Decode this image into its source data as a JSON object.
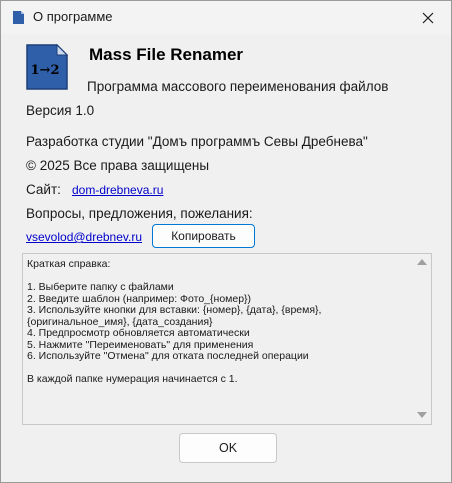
{
  "window": {
    "title": "О программе",
    "close_glyph": "✕"
  },
  "app": {
    "icon_label": "1→2",
    "name": "Mass File Renamer",
    "description": "Программа массового переименования файлов",
    "version": "Версия 1.0",
    "developer": "Разработка студии \"Домъ программъ Севы Дребнева\"",
    "copyright": "© 2025 Все права защищены"
  },
  "site": {
    "label": "Сайт:",
    "link": "dom-drebneva.ru"
  },
  "contact": {
    "prompt": "Вопросы, предложения, пожелания:",
    "email": "vsevolod@drebnev.ru",
    "copy_label": "Копировать"
  },
  "help": {
    "lines": [
      "Краткая справка:",
      "",
      "1. Выберите папку с файлами",
      "2. Введите шаблон (например: Фото_{номер})",
      "3. Используйте кнопки для вставки: {номер}, {дата}, {время},",
      "{оригинальное_имя}, {дата_создания}",
      "4. Предпросмотр обновляется автоматически",
      "5. Нажмите \"Переименовать\" для применения",
      "6. Используйте \"Отмена\" для отката последней операции",
      "",
      "В каждой папке нумерация начинается с 1."
    ]
  },
  "buttons": {
    "ok_label": "OK"
  },
  "colors": {
    "icon_blue": "#2f5fa8",
    "link": "#0000cc",
    "accent_border": "#0078d4"
  }
}
